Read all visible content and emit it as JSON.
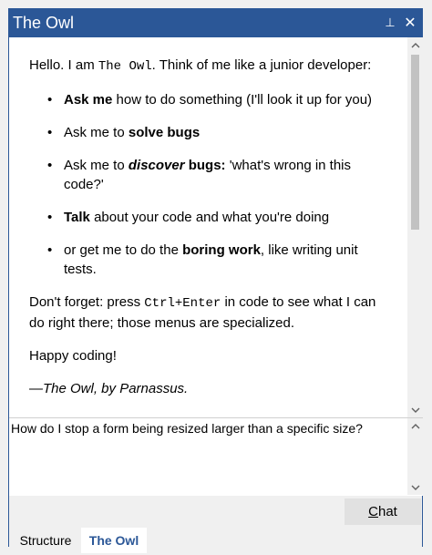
{
  "window": {
    "title": "The Owl",
    "pin_glyph": "⊥",
    "close_glyph": "✕",
    "accent_color": "#2b5797"
  },
  "chat": {
    "intro": {
      "prefix": "Hello. I am ",
      "code": "The Owl",
      "suffix": ". Think of me like a junior developer:"
    },
    "bullets": [
      {
        "b1": "Ask me",
        "t1": " how to do something (I'll look it up for you)"
      },
      {
        "t0": "Ask me to ",
        "b1": "solve bugs"
      },
      {
        "t0": "Ask me to ",
        "bi": "discover",
        "b1": " bugs:",
        "t1": " 'what's wrong in this code?'"
      },
      {
        "b1": "Talk",
        "t1": " about your code and what you're doing"
      },
      {
        "t0": "or get me to do the ",
        "b1": "boring work",
        "t1": ", like writing unit tests."
      }
    ],
    "dont_forget": {
      "prefix": "Don't forget: press ",
      "code": "Ctrl+Enter",
      "suffix": " in code to see what I can do right there; those menus are specialized."
    },
    "happy": "Happy coding!",
    "signature": "—The Owl, by Parnassus."
  },
  "input": {
    "value": "How do I stop a form being resized larger than a specific size?"
  },
  "buttons": {
    "chat_mnemonic": "C",
    "chat_rest": "hat"
  },
  "tabs": [
    {
      "label": "Structure",
      "active": false
    },
    {
      "label": "The Owl",
      "active": true
    }
  ],
  "icons": {
    "scroll_up": "up-arrow-icon",
    "scroll_down": "down-arrow-icon"
  }
}
